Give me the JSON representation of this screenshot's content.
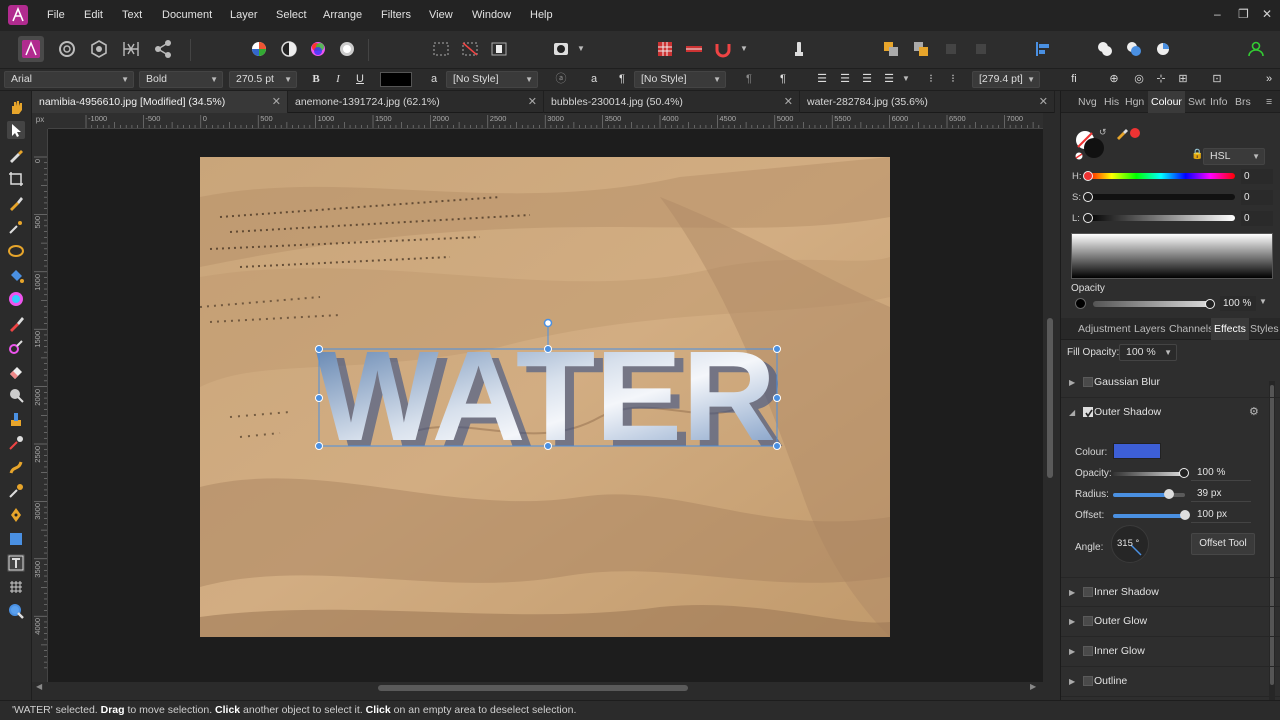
{
  "menu": [
    "File",
    "Edit",
    "Text",
    "Document",
    "Layer",
    "Select",
    "Arrange",
    "Filters",
    "View",
    "Window",
    "Help"
  ],
  "window_controls": {
    "minimize": "–",
    "restore": "❐",
    "close": "✕"
  },
  "context": {
    "font": "Arial",
    "weight": "Bold",
    "size": "270.5 pt",
    "bold": "B",
    "italic": "I",
    "underline": "U",
    "char_style": "[No Style]",
    "para_style": "[No Style]",
    "spacing": "[279.4 pt]",
    "text_glyph": "a",
    "pilcrow": "¶",
    "fi_glyph": "fi"
  },
  "tabs": [
    {
      "title": "namibia-4956610.jpg [Modified] (34.5%)",
      "active": true
    },
    {
      "title": "anemone-1391724.jpg (62.1%)",
      "active": false
    },
    {
      "title": "bubbles-230014.jpg (50.4%)",
      "active": false
    },
    {
      "title": "water-282784.jpg (35.6%)",
      "active": false
    }
  ],
  "ruler": {
    "unit": "px",
    "h_ticks": [
      "-1000",
      "-500",
      "0",
      "500",
      "1000",
      "1500",
      "2000",
      "2500",
      "3000",
      "3500",
      "4000",
      "4500",
      "5000",
      "5500",
      "6000",
      "6500",
      "7000"
    ],
    "v_ticks": [
      "0",
      "500",
      "1000",
      "1500",
      "2000",
      "2500",
      "3000",
      "3500",
      "4000"
    ]
  },
  "canvas_text": "WATER",
  "panel_tabs_top": [
    "Nvg",
    "His",
    "Hgn",
    "Colour",
    "Swt",
    "Info",
    "Brs"
  ],
  "colour": {
    "model": "HSL",
    "h_label": "H:",
    "s_label": "S:",
    "l_label": "L:",
    "h": "0",
    "s": "0",
    "l": "0",
    "opacity_label": "Opacity",
    "opacity": "100 %"
  },
  "panel_tabs_bottom": [
    "Adjustment",
    "Layers",
    "Channels",
    "Effects",
    "Styles"
  ],
  "effects": {
    "fill_opacity_label": "Fill Opacity:",
    "fill_opacity": "100 %",
    "gaussian_blur": "Gaussian Blur",
    "outer_shadow": "Outer Shadow",
    "colour_label": "Colour:",
    "colour": "#3d5fd6",
    "opacity_label": "Opacity:",
    "opacity": "100 %",
    "radius_label": "Radius:",
    "radius": "39 px",
    "offset_label": "Offset:",
    "offset": "100 px",
    "angle_label": "Angle:",
    "angle": "315 °",
    "offset_tool": "Offset Tool",
    "inner_shadow": "Inner Shadow",
    "outer_glow": "Outer Glow",
    "inner_glow": "Inner Glow",
    "outline": "Outline"
  },
  "status": {
    "selected": "'WATER' selected. ",
    "drag": "Drag",
    "drag_text": " to move selection. ",
    "click": "Click",
    "click_text": " another object to select it. ",
    "click2": "Click",
    "click2_text": " on an empty area to deselect selection."
  }
}
